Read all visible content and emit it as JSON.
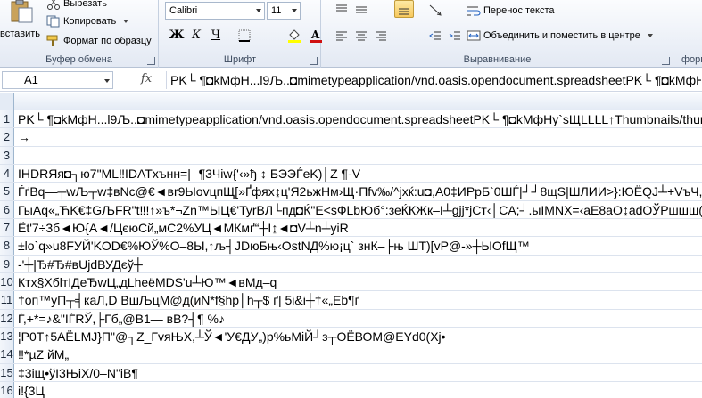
{
  "ribbon": {
    "clipboard": {
      "paste_label": "вставить",
      "cut_label": "Вырезать",
      "copy_label": "Копировать",
      "format_painter_label": "Формат по образцу",
      "group_label": "Буфер обмена"
    },
    "font": {
      "font_name": "Calibri",
      "font_size": "11",
      "bold_label": "Ж",
      "italic_label": "К",
      "underline_label": "Ч",
      "fill_color": "#ffff00",
      "font_color": "#d01010",
      "group_label": "Шрифт"
    },
    "alignment": {
      "wrap_text_label": "Перенос текста",
      "merge_center_label": "Объединить и поместить в центре",
      "group_label": "Выравнивание"
    },
    "next_group_label": "форм"
  },
  "formula_bar": {
    "name_box": "A1",
    "fx_label": "fx",
    "formula": "PK└ ¶◘kMфН...l9Љ..◘mimetypeapplication/vnd.oasis.opendocument.spreadsheetPK└ ¶◘kMфН"
  },
  "rows": [
    {
      "num": "1",
      "text": "PK└ ¶◘kMфН...l9Љ..◘mimetypeapplication/vnd.oasis.opendocument.spreadsheetPK└ ¶◘kMфНу`sЩLLLL↑Thumbnails/thum"
    },
    {
      "num": "2",
      "text": "→"
    },
    {
      "num": "3",
      "text": ""
    },
    {
      "num": "4",
      "text": "IHDRЯя◘┐ю7\"ML‼IDATxънн=|│¶3Чiw{'‹»ђ   ↕ БЭЭЃeK)│Z ¶-V"
    },
    {
      "num": "5",
      "text": "ЃґBq—┬wЉ┬w‡вNc@€◄вr9ЫovцпЩ[»Ґфях↨ц'Я2ьжНм›Щ·Пfv‰/^jxќ:u◘,A0‡ИРрБ`0ШЃ|┘┘8щS|ШЛИИ>}:ЮЁQJ┴+VъЧ,Йря"
    },
    {
      "num": "6",
      "text": "ГыAq«„ЋK€‡GЉFR\"t‼!↑»ъ*¬Zn™ЫЦ€'TyrBЛ└пд◘Ќ\"E<sФLbЮб°:зеЌКЖк–I┴gjj*jCт‹│CA;┘.ыIMNX=‹aE8aO↨adOЎРшшш(•JRAя—:K"
    },
    {
      "num": "7",
      "text": "Ёt'7÷3б◄Ю{A◄/ЦєюСй„мС2%УЦ◄МКмґ“┼I↨◄◘V┴n┴yiR"
    },
    {
      "num": "8",
      "text": "±lo`q»u8FУЙ'KOD€%ЮЎ%О–8Ы,↑љ┤JDюБњ‹OstNД%ю¡ц`   знК–├њ    ШТ)[vP@-»┼ЫOfЩ™"
    },
    {
      "num": "9",
      "text": "-'┼|Ђ#Ђ#вUjdВУДєў┼"
    },
    {
      "num": "10",
      "text": "Ктх§ХбlтIДеЂwЦ„дLheёMDS'u┴Ю™◄вMд–q"
    },
    {
      "num": "11",
      "text": "†оп™уП┬╡каЛ,D    ВшЉцМ@д(иN*f§hp│h┬$ ґ| 5i&i┼†«„Eb¶ґ"
    },
    {
      "num": "12",
      "text": "Ѓ,+*=♪&\"IЃRЎ,├Гб„@B1— вВ?┤¶    %♪"
    },
    {
      "num": "13",
      "text": "¦P0T↑5AЁLMJ}П\"@┐Z_ГvяЊX,┴Ў◄'У€ДУ„)p%ьМіЙ┘з┬ОЁВОМ@ЕYd0(Xj•"
    },
    {
      "num": "14",
      "text": "‼*µZ    йМ„"
    },
    {
      "num": "15",
      "text": "‡3iщ•ўI3ЊiX/0–N\"iB¶"
    },
    {
      "num": "16",
      "text": "i!{3Ц"
    }
  ]
}
